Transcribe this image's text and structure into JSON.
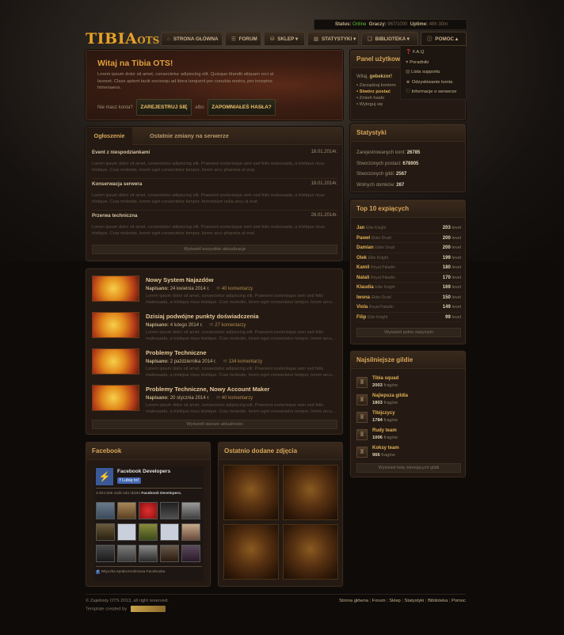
{
  "status": {
    "status_label": "Status:",
    "status_value": "Online",
    "players_label": "Graczy:",
    "players_value": "967/1000",
    "uptime_label": "Uptime:",
    "uptime_value": "48h 30m"
  },
  "logo": {
    "text1": "TIBIA",
    "text2": "OTS"
  },
  "nav": {
    "items": [
      "STRONA GŁÓWNA",
      "FORUM",
      "SKLEP",
      "STATYSTYKI",
      "BIBLIOTEKA",
      "POMOC"
    ]
  },
  "dropdown": {
    "items": [
      "F.A.Q",
      "Poradniki",
      "Lista supportu",
      "Odzyskiwanie konta",
      "Informacje o serwerze"
    ]
  },
  "welcome": {
    "title": "Witaj na Tibia OTS!",
    "text": "Lorem ipsum dolor sit amet, consectetur adipiscing elit. Quisque blandit aliquam orci at laoreet. Class aptent taciti sociosqu ad litora torquent per conubia nostra, per inceptos himenaeos.",
    "no_account": "Nie masz konta?",
    "register_btn": "ZAREJESTRUJ SIĘ",
    "or": "albo",
    "forgot_btn": "ZAPOMNIAŁEŚ HASŁA?"
  },
  "user_panel": {
    "title": "Panel użytkownika",
    "greeting_prefix": "Witaj,",
    "username": "gebekzor!",
    "links": [
      "Zarządzaj kontem",
      "Stwórz postać",
      "Zmień hasło",
      "Wyloguj się"
    ]
  },
  "announcements": {
    "tabs": [
      "Ogłoszenie",
      "Ostatnie zmiany na serwerze"
    ],
    "items": [
      {
        "title": "Event z niespodziankami",
        "date": "18.01.2014r.",
        "text": "Lorem ipsum dolor sit amet, consectetur adipiscing elit. Praesent scelerisque sem sed felis malesuada, a tristique risus tristique. Cras molestie, lorem eget consectetur tempor, lorem arcu pharetra ut erat."
      },
      {
        "title": "Konserwacja serwera",
        "date": "18.01.2014r.",
        "text": "Lorem ipsum dolor sit amet, consectetur adipiscing elit. Praesent scelerisque sem sed felis malesuada, a tristique risus tristique. Cras molestie, lorem eget consectetur tempor, fermentum nulla arcu ut erat."
      },
      {
        "title": "Przerwa techniczna",
        "date": "26.01.2014r.",
        "text": "Lorem ipsum dolor sit amet, consectetur adipiscing elit. Praesent scelerisque sem sed felis malesuada, a tristique risus tristique. Cras molestie, lorem eget consectetur tempor, lorem arcu pharetra ut erat."
      }
    ],
    "show_all": "Wyświetl wszystkie aktualizacje"
  },
  "news": {
    "posted_label": "Napisano:",
    "items": [
      {
        "title": "Nowy System Najazdów",
        "date": "24 kwietnia 2014 r.",
        "comments": "40 komentarzy",
        "text": "Lorem ipsum dolor sit amet, consectetur adipiscing elit. Praesent scelerisque sem sed felis malesuada, a tristique risus tristique. Cras molestie, lorem eget consectetur tempor, lorem arcu..."
      },
      {
        "title": "Dzisiaj podwójne punkty doświadczenia",
        "date": "4 lutego 2014 r.",
        "comments": "27 komentarzy",
        "text": "Lorem ipsum dolor sit amet, consectetur adipiscing elit. Praesent scelerisque sem sed felis malesuada, a tristique risus tristique. Cras molestie, lorem eget consectetur tempor, lorem arcu..."
      },
      {
        "title": "Problemy Techniczne",
        "date": "2 października 2014 r.",
        "comments": "134 komentarzy",
        "text": "Lorem ipsum dolor sit amet, consectetur adipiscing elit. Praesent scelerisque sem sed felis malesuada, a tristique risus tristique. Cras molestie, lorem eget consectetur tempor, lorem arcu..."
      },
      {
        "title": "Problemy Techniczne, Nowy Account Maker",
        "date": "20 stycznia 2014 r.",
        "comments": "40 komentarzy",
        "text": "Lorem ipsum dolor sit amet, consectetur adipiscing elit. Praesent scelerisque sem sed felis malesuada, a tristique risus tristique. Cras molestie, lorem eget consectetur tempor, lorem arcu..."
      }
    ],
    "show_older": "Wyświetl starsze aktualności"
  },
  "stats": {
    "title": "Statystyki",
    "rows": [
      {
        "label": "Zarejestrowanych kont:",
        "value": "26785"
      },
      {
        "label": "Stworzonych postaci:",
        "value": "678905"
      },
      {
        "label": "Stworzonych gildi:",
        "value": "2567"
      },
      {
        "label": "Wolnych domków:",
        "value": "267"
      }
    ]
  },
  "top10": {
    "title": "Top 10 expiących",
    "level_label": "level",
    "rows": [
      {
        "name": "Jan",
        "voc": "Elite Knight",
        "level": "203"
      },
      {
        "name": "Paweł",
        "voc": "Elder Druid",
        "level": "200"
      },
      {
        "name": "Damian",
        "voc": "Elder Druid",
        "level": "200"
      },
      {
        "name": "Olek",
        "voc": "Elite Knight",
        "level": "199"
      },
      {
        "name": "Kamil",
        "voc": "Royal Paladin",
        "level": "180"
      },
      {
        "name": "Natali",
        "voc": "Royal Paladin",
        "level": "170"
      },
      {
        "name": "Klaudia",
        "voc": "Elite Knight",
        "level": "169"
      },
      {
        "name": "Iwona",
        "voc": "Elder Druid",
        "level": "150"
      },
      {
        "name": "Viola",
        "voc": "Royal Paladin",
        "level": "149"
      },
      {
        "name": "Filip",
        "voc": "Elite Knight",
        "level": "99"
      }
    ],
    "show_full": "Wyświetl pełne statystyki"
  },
  "guilds": {
    "title": "Najsilniejsze gildie",
    "frags_label": "fragów",
    "rows": [
      {
        "name": "Tibia squad",
        "frags": "2003"
      },
      {
        "name": "Najlepsza gildia",
        "frags": "1803"
      },
      {
        "name": "Tibijczycy",
        "frags": "1784"
      },
      {
        "name": "Rudy team",
        "frags": "1006"
      },
      {
        "name": "Koksy team",
        "frags": "966"
      }
    ],
    "show_all": "Wyświetl listę istniejących gildii"
  },
  "facebook": {
    "title": "Facebook",
    "page_name": "Facebook Developers",
    "like_btn": "Lubię to!",
    "likes_count": "3.004.939",
    "likes_text": "osób lubi obiekt",
    "likes_page": "Facebook Developers.",
    "plugin_text": "Wtyczka społecznościowa Facebooka"
  },
  "photos": {
    "title": "Ostatnio dodane zdjęcia"
  },
  "footer": {
    "copy": "© Zajebisty OTS 2013, all right reserved.",
    "credit": "Template created by",
    "links": [
      "Strona główna",
      "Forum",
      "Sklep",
      "Statystyki",
      "Biblioteka",
      "Pomoc"
    ]
  }
}
